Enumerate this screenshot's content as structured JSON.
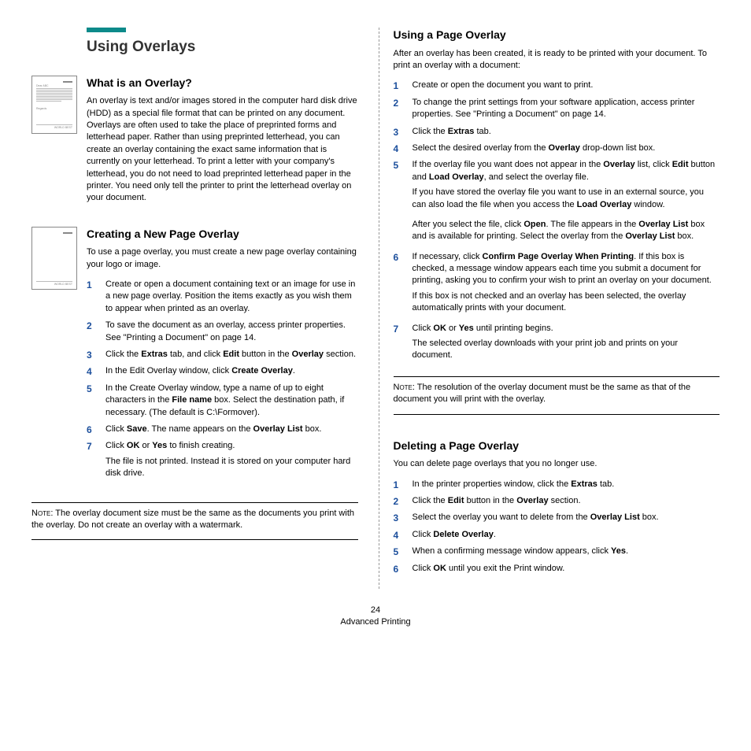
{
  "title": "Using Overlays",
  "s1": {
    "heading": "What is an Overlay?",
    "body": "An overlay is text and/or images stored in the computer hard disk drive (HDD) as a special file format that can be printed on any document. Overlays are often used to take the place of preprinted forms and letterhead paper. Rather than using preprinted letterhead, you can create an overlay containing the exact same information that is currently on your letterhead. To print a letter with your company's letterhead, you do not need to load preprinted letterhead paper in the printer. You need only tell the printer to print the letterhead overlay on your document."
  },
  "s2": {
    "heading": "Creating a New Page Overlay",
    "intro": "To use a page overlay, you must create a new page overlay containing your logo or image.",
    "step1": "Create or open a document containing text or an image for use in a new page overlay. Position the items exactly as you wish them to appear when printed as an overlay.",
    "step2": "To save the document as an overlay, access printer properties. See \"Printing a Document\" on page 14.",
    "step3a": "Click the ",
    "step3b": "Extras",
    "step3c": " tab, and click ",
    "step3d": "Edit",
    "step3e": " button in the ",
    "step3f": "Overlay",
    "step3g": " section.",
    "step4a": "In the Edit Overlay window, click ",
    "step4b": "Create Overlay",
    "step4c": ".",
    "step5a": "In the Create Overlay window, type a name of up to eight characters in the ",
    "step5b": "File name",
    "step5c": " box. Select the destination path, if necessary. (The default is C:\\Formover).",
    "step6a": "Click ",
    "step6b": "Save",
    "step6c": ". The name appears on the ",
    "step6d": "Overlay List",
    "step6e": " box.",
    "step7a": "Click ",
    "step7b": "OK",
    "step7c": " or ",
    "step7d": "Yes",
    "step7e": " to finish creating.",
    "step7_sub": "The file is not printed. Instead it is stored on your computer hard disk drive.",
    "note_label": "Note",
    "note": ": The overlay document size must be the same as the documents you print with the overlay. Do not create an overlay with a watermark."
  },
  "s3": {
    "heading": "Using a Page Overlay",
    "intro": "After an overlay has been created, it is ready to be printed with your document. To print an overlay with a document:",
    "st1": "Create or open the document you want to print.",
    "st2": "To change the print settings from your software application, access printer properties. See \"Printing a Document\" on page 14.",
    "st3a": "Click the ",
    "st3b": "Extras",
    "st3c": " tab.",
    "st4a": "Select the desired overlay from the ",
    "st4b": "Overlay",
    "st4c": " drop-down list box.",
    "st5a": "If the overlay file you want does not appear in the ",
    "st5b": "Overlay",
    "st5c": " list, click ",
    "st5d": "Edit",
    "st5e": " button and ",
    "st5f": "Load Overlay",
    "st5g": ", and select the overlay file.",
    "st5_sub1a": "If you have stored the overlay file you want to use in an external source, you can also load the file when you access the ",
    "st5_sub1b": "Load Overlay",
    "st5_sub1c": " window.",
    "st5_sub2a": "After you select the file, click ",
    "st5_sub2b": "Open",
    "st5_sub2c": ". The file appears in the ",
    "st5_sub2d": "Overlay List",
    "st5_sub2e": " box and is available for printing. Select the overlay from the ",
    "st5_sub2f": "Overlay List",
    "st5_sub2g": " box.",
    "st6a": "If necessary, click ",
    "st6b": "Confirm Page Overlay When Printing",
    "st6c": ". If this box is checked, a message window appears each time you submit a document for printing, asking you to confirm your wish to print an overlay on your document.",
    "st6_sub": "If this box is not checked and an overlay has been selected, the overlay automatically prints with your document.",
    "st7a": "Click ",
    "st7b": "OK",
    "st7c": " or ",
    "st7d": "Yes",
    "st7e": " until printing begins.",
    "st7_sub": "The selected overlay downloads with your print job and prints on your document.",
    "note_label": "Note",
    "note": ": The resolution of the overlay document must be the same as that of the document you will print with the overlay."
  },
  "s4": {
    "heading": "Deleting a Page Overlay",
    "intro": "You can delete page overlays that you no longer use.",
    "st1a": "In the printer properties window, click the ",
    "st1b": "Extras",
    "st1c": " tab.",
    "st2a": "Click the ",
    "st2b": "Edit",
    "st2c": " button in the ",
    "st2d": "Overlay",
    "st2e": " section.",
    "st3a": "Select the overlay you want to delete from the ",
    "st3b": "Overlay List",
    "st3c": " box.",
    "st4a": "Click ",
    "st4b": "Delete Overlay",
    "st4c": ".",
    "st5a": "When a confirming message window appears, click ",
    "st5b": "Yes",
    "st5c": ".",
    "st6a": "Click ",
    "st6b": "OK",
    "st6c": " until you exit the Print window."
  },
  "footer": {
    "page": "24",
    "section": "Advanced Printing"
  },
  "icon": {
    "top": "Dear ABC",
    "bot": "WORLD BEST"
  }
}
